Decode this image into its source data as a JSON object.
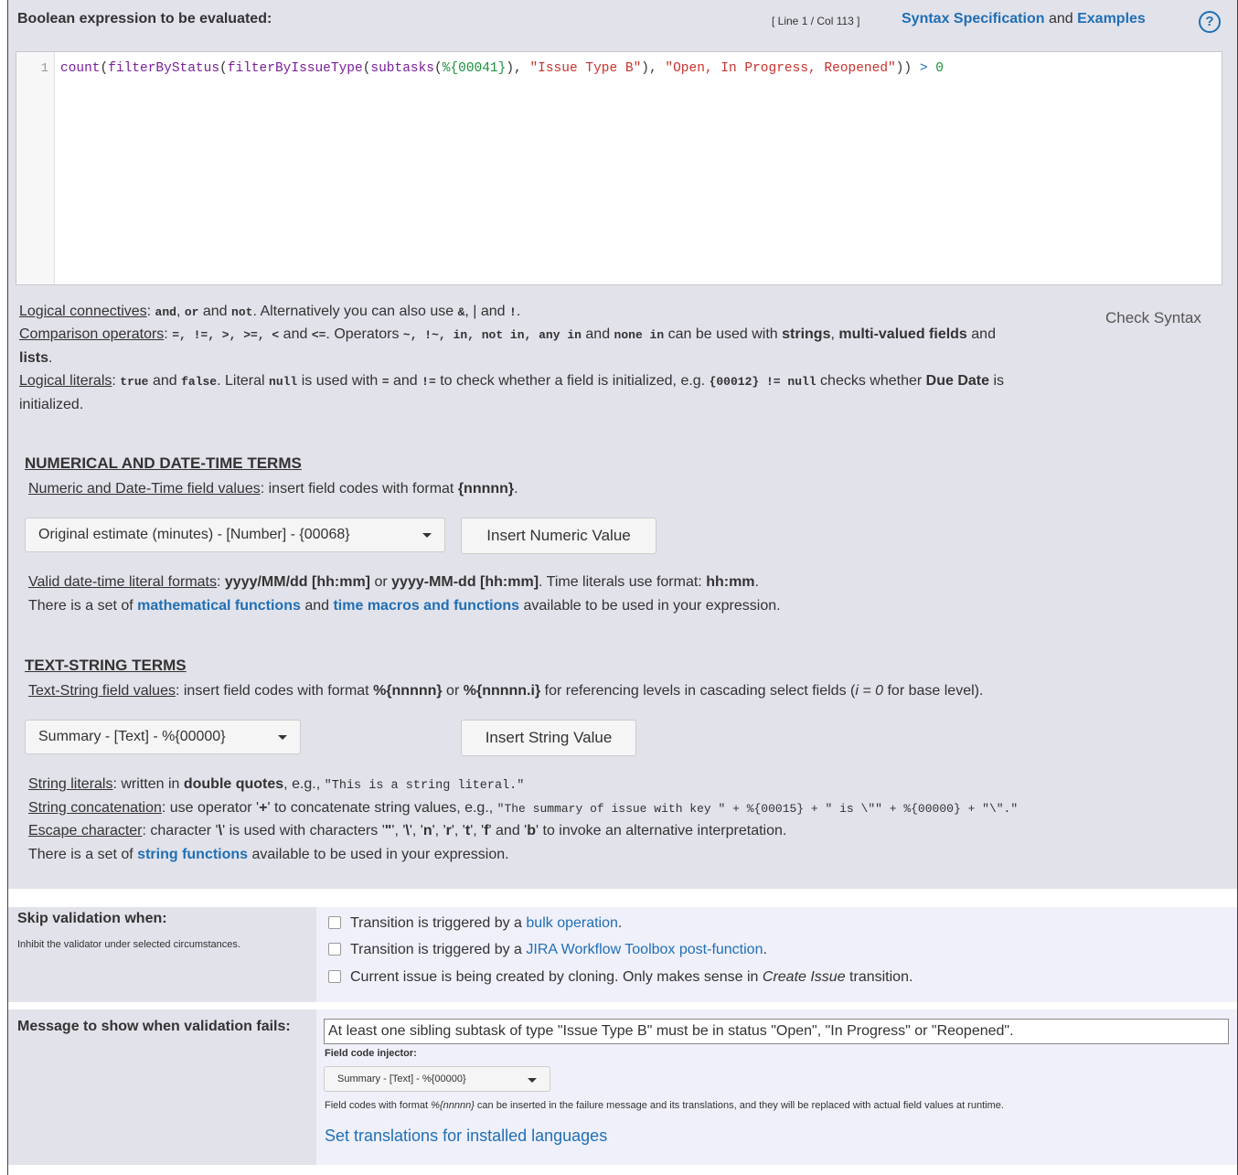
{
  "header": {
    "title": "Boolean expression to be evaluated:",
    "cursor_position": "[ Line 1 / Col 113 ]",
    "syntax_spec_link": "Syntax Specification",
    "and_text": "and",
    "examples_link": "Examples",
    "help_glyph": "?"
  },
  "editor": {
    "line_number": "1",
    "tokens": {
      "t1": "count",
      "t2": "(",
      "t3": "filterByStatus",
      "t4": "(",
      "t5": "filterByIssueType",
      "t6": "(",
      "t7": "subtasks",
      "t8": "(",
      "t9": "%{00041}",
      "t10": "), ",
      "t11": "\"Issue Type B\"",
      "t12": "), ",
      "t13": "\"Open, In Progress, Reopened\"",
      "t14": ")) ",
      "t15": ">",
      "t16": " ",
      "t17": "0"
    }
  },
  "help": {
    "logical_connectives": {
      "label": "Logical connectives",
      "p1": ": ",
      "and": "and",
      "p2": ", ",
      "or": "or",
      "p3": " and ",
      "not": "not",
      "p4": ". Alternatively you can also use ",
      "amp": "&",
      "p5": ", | and ",
      "bang": "!",
      "p6": "."
    },
    "comparison": {
      "label": "Comparison operators",
      "p1": ": ",
      "ops1": "=, !=, >, >=, <",
      "p2": " and ",
      "ops2": "<=",
      "p3": ". Operators ",
      "ops3": "~, !~, in, not in, any in",
      "p4": " and ",
      "ops4": "none in",
      "p5": " can be used with ",
      "b1": "strings",
      "p6": ", ",
      "b2": "multi-valued fields",
      "p7": " and ",
      "b3": "lists",
      "p8": "."
    },
    "literals": {
      "label": "Logical literals",
      "p1": ": ",
      "true": "true",
      "p2": " and ",
      "false": "false",
      "p3": ". Literal ",
      "null": "null",
      "p4": " is used with ",
      "eq": "=",
      "p5": " and ",
      "neq": "!=",
      "p6": " to check whether a field is initialized, e.g. ",
      "example": "{00012} != null",
      "p7": " checks whether ",
      "due": "Due Date",
      "p8": " is initialized."
    },
    "check_syntax": "Check Syntax"
  },
  "numerical": {
    "title": "NUMERICAL AND DATE-TIME TERMS",
    "field_values_label": "Numeric and Date-Time field values",
    "field_values_text": ": insert field codes with format ",
    "field_values_format": "{nnnnn}",
    "field_values_end": ".",
    "dropdown_value": "Original estimate (minutes) - [Number] - {00068}",
    "insert_button": "Insert Numeric Value",
    "formats_label": "Valid date-time literal formats",
    "formats_p1": ": ",
    "formats_f1": "yyyy/MM/dd [hh:mm]",
    "formats_p2": " or ",
    "formats_f2": "yyyy-MM-dd [hh:mm]",
    "formats_p3": ". Time literals use format: ",
    "formats_f3": "hh:mm",
    "formats_p4": ".",
    "functions_p1": "There is a set of ",
    "math_link": "mathematical functions",
    "functions_p2": " and ",
    "time_link": "time macros and functions",
    "functions_p3": " available to be used in your expression."
  },
  "text": {
    "title": "TEXT-STRING TERMS",
    "field_values_label": "Text-String field values",
    "fv_p1": ": insert field codes with format ",
    "fv_f1": "%{nnnnn}",
    "fv_p2": " or ",
    "fv_f2": "%{nnnnn.i}",
    "fv_p3": " for referencing levels in cascading select fields (",
    "fv_i": "i = 0",
    "fv_p4": " for base level).",
    "dropdown_value": "Summary - [Text] - %{00000}",
    "insert_button": "Insert String Value",
    "sl_label": "String literals",
    "sl_p1": ": written in ",
    "sl_b": "double quotes",
    "sl_p2": ", e.g., ",
    "sl_ex": "\"This is a string literal.\"",
    "sc_label": "String concatenation",
    "sc_p1": ": use operator '",
    "sc_plus": "+",
    "sc_p2": "' to concatenate string values, e.g., ",
    "sc_ex": "\"The summary of issue with key \" + %{00015} + \" is \\\"\" + %{00000} + \"\\\".\"",
    "ec_label": "Escape character",
    "ec_p1": ": character '",
    "ec_bs": "\\",
    "ec_p2": "' is used with characters '",
    "ec_c1": "\"",
    "ec_p3": "', '",
    "ec_c2": "\\",
    "ec_p4": "', '",
    "ec_c3": "n",
    "ec_p5": "', '",
    "ec_c4": "r",
    "ec_p6": "', '",
    "ec_c5": "t",
    "ec_p7": "', '",
    "ec_c6": "f",
    "ec_p8": "' and '",
    "ec_c7": "b",
    "ec_p9": "' to invoke an alternative interpretation.",
    "sf_p1": "There is a set of ",
    "sf_link": "string functions",
    "sf_p2": " available to be used in your expression."
  },
  "skip": {
    "title": "Skip validation when:",
    "note": "Inhibit the validator under selected circumstances.",
    "options": [
      {
        "pre": "Transition is triggered by a ",
        "link": "bulk operation",
        "post": ".",
        "checked": false
      },
      {
        "pre": "Transition is triggered by a ",
        "link": "JIRA Workflow Toolbox post-function",
        "post": ".",
        "checked": false
      }
    ],
    "option3_pre": "Current issue is being created by cloning. Only makes sense in ",
    "option3_em": "Create Issue",
    "option3_post": " transition."
  },
  "message": {
    "title": "Message to show when validation fails:",
    "value": "At least one sibling subtask of type \"Issue Type B\" must be in status \"Open\", \"In Progress\" or \"Reopened\".",
    "injector_label": "Field code injector:",
    "injector_value": "Summary - [Text] - %{00000}",
    "note_p1": "Field codes with format ",
    "note_em": "%{nnnnn}",
    "note_p2": " can be inserted in the failure message and its translations, and they will be replaced with actual field values at runtime.",
    "translations_link": "Set translations for installed languages"
  },
  "colors": {
    "panel_bg": "#e2e2ea",
    "link": "#1f6fb5",
    "right_cell_bg": "#f0f0fa"
  }
}
